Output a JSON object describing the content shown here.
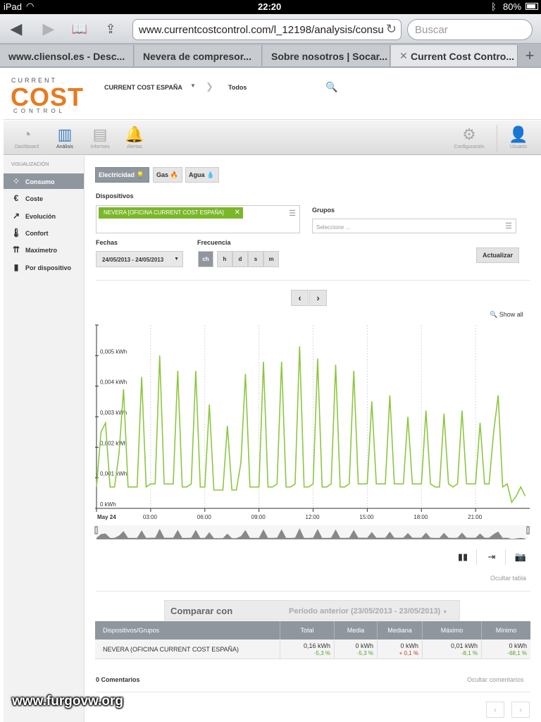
{
  "status_bar": {
    "device": "iPad",
    "time": "22:20",
    "battery": "80%"
  },
  "browser": {
    "url": "www.currentcostcontrol.com/l_12198/analysis/consu",
    "search_placeholder": "Buscar",
    "tabs": [
      {
        "title": "www.cliensol.es - Desc..."
      },
      {
        "title": "Nevera de compresor..."
      },
      {
        "title": "Sobre nosotros | Socar..."
      },
      {
        "title": "Current Cost Contro..."
      }
    ]
  },
  "header": {
    "logo": {
      "line1": "CURRENT",
      "line2": "COST",
      "line3": "CONTROL"
    },
    "organization": "CURRENT COST ESPAÑA",
    "scope": "Todos"
  },
  "nav": {
    "items": [
      {
        "label": "Dashboard",
        "icon": "gauge-icon"
      },
      {
        "label": "Análisis",
        "icon": "bar-chart-icon"
      },
      {
        "label": "Informes",
        "icon": "report-icon"
      },
      {
        "label": "Alertas",
        "icon": "bell-icon"
      },
      {
        "label": "Configuración",
        "icon": "gear-icon"
      },
      {
        "label": "Usuario",
        "icon": "user-icon"
      }
    ]
  },
  "sidebar": {
    "heading": "VISUALIZACIÓN",
    "items": [
      {
        "label": "Consumo",
        "icon": "consumption-icon"
      },
      {
        "label": "Coste",
        "icon": "euro-icon"
      },
      {
        "label": "Evolución",
        "icon": "line-chart-icon"
      },
      {
        "label": "Confort",
        "icon": "thermometer-icon"
      },
      {
        "label": "Maxímetro",
        "icon": "peak-icon"
      },
      {
        "label": "Por dispositivo",
        "icon": "bars-icon"
      }
    ]
  },
  "utilities": [
    {
      "label": "Electricidad"
    },
    {
      "label": "Gas"
    },
    {
      "label": "Agua"
    }
  ],
  "filters": {
    "devices_label": "Dispositivos",
    "device_chip": "NEVERA [OFICINA CURRENT COST ESPAÑA]",
    "groups_label": "Grupos",
    "groups_placeholder": "Seleccione ...",
    "dates_label": "Fechas",
    "date_range": "24/05/2013 - 24/05/2013",
    "frequency_label": "Frecuencia",
    "frequency_options": [
      "ch",
      "h",
      "d",
      "s",
      "m"
    ],
    "update_button": "Actualizar"
  },
  "chart_controls": {
    "show_all": "Show all",
    "hide_table": "Ocultar tabla"
  },
  "chart_data": {
    "type": "line",
    "title": "",
    "ylabel": "",
    "xlabel": "",
    "unit": "kWh",
    "y_ticks": [
      "0 kWh",
      "0,001 kWh",
      "0,002 kWh",
      "0,003 kWh",
      "0,004 kWh",
      "0,005 kWh"
    ],
    "ylim": [
      0,
      0.006
    ],
    "x_ticks": [
      "May 24",
      "03:00",
      "06:00",
      "09:00",
      "12:00",
      "15:00",
      "18:00",
      "21:00"
    ],
    "x_hours": [
      0,
      3,
      6,
      9,
      12,
      15,
      18,
      21
    ],
    "xlim_hours": [
      0,
      24
    ],
    "grid": true,
    "color": "#8dc63f",
    "series": [
      {
        "name": "",
        "hours": [
          0.0,
          0.25,
          0.5,
          0.75,
          1.0,
          1.25,
          1.5,
          1.75,
          2.0,
          2.25,
          2.5,
          2.75,
          3.0,
          3.25,
          3.5,
          3.75,
          4.0,
          4.25,
          4.5,
          4.75,
          5.0,
          5.25,
          5.5,
          5.75,
          6.0,
          6.25,
          6.5,
          6.75,
          7.0,
          7.25,
          7.5,
          7.75,
          8.0,
          8.25,
          8.5,
          8.75,
          9.0,
          9.25,
          9.5,
          9.75,
          10.0,
          10.25,
          10.5,
          10.75,
          11.0,
          11.25,
          11.5,
          11.75,
          12.0,
          12.25,
          12.5,
          12.75,
          13.0,
          13.25,
          13.5,
          13.75,
          14.0,
          14.25,
          14.5,
          14.75,
          15.0,
          15.25,
          15.5,
          15.75,
          16.0,
          16.25,
          16.5,
          16.75,
          17.0,
          17.25,
          17.5,
          17.75,
          18.0,
          18.25,
          18.5,
          18.75,
          19.0,
          19.25,
          19.5,
          19.75,
          20.0,
          20.25,
          20.5,
          20.75,
          21.0,
          21.25,
          21.5,
          21.75,
          22.0,
          22.25,
          22.5,
          22.75,
          23.0,
          23.25,
          23.5,
          23.75
        ],
        "values": [
          0.0007,
          0.0025,
          0.0028,
          0.0007,
          0.0007,
          0.0018,
          0.0039,
          0.0007,
          0.0007,
          0.0007,
          0.0043,
          0.0007,
          0.0008,
          0.0008,
          0.005,
          0.0008,
          0.0008,
          0.0008,
          0.0045,
          0.0007,
          0.0007,
          0.0008,
          0.0045,
          0.0007,
          0.0007,
          0.0034,
          0.0006,
          0.0006,
          0.0006,
          0.0027,
          0.0006,
          0.0006,
          0.0015,
          0.0044,
          0.0007,
          0.0007,
          0.0007,
          0.0048,
          0.0007,
          0.0007,
          0.0008,
          0.0048,
          0.0007,
          0.0007,
          0.0008,
          0.0053,
          0.0007,
          0.0007,
          0.0008,
          0.0049,
          0.0007,
          0.0007,
          0.0008,
          0.0047,
          0.0007,
          0.0007,
          0.0008,
          0.0045,
          0.0008,
          0.0008,
          0.0008,
          0.0035,
          0.0008,
          0.0008,
          0.0008,
          0.0037,
          0.0008,
          0.0008,
          0.0008,
          0.003,
          0.0008,
          0.0008,
          0.0008,
          0.0032,
          0.0008,
          0.0007,
          0.0007,
          0.0031,
          0.0008,
          0.0007,
          0.0008,
          0.0032,
          0.0008,
          0.0008,
          0.0008,
          0.0028,
          0.0008,
          0.0008,
          0.0025,
          0.0037,
          0.0007,
          0.0008,
          0.0002,
          0.0004,
          0.0007,
          0.0004
        ]
      }
    ]
  },
  "compare": {
    "label": "Comparar con",
    "period": "Período anterior (23/05/2013 - 23/05/2013)"
  },
  "table": {
    "columns": [
      "Dispositivos/Grupos",
      "Total",
      "Media",
      "Mediana",
      "Máximo",
      "Mínimo"
    ],
    "rows": [
      {
        "name": "NEVERA (OFICINA CURRENT COST ESPAÑA)",
        "cells": [
          {
            "value": "0,16 kWh",
            "delta": "-5,3 %",
            "dir": "neg"
          },
          {
            "value": "0 kWh",
            "delta": "-5,3 %",
            "dir": "neg"
          },
          {
            "value": "0 kWh",
            "delta": "+ 0,1 %",
            "dir": "pos"
          },
          {
            "value": "0,01 kWh",
            "delta": "-8,1 %",
            "dir": "neg"
          },
          {
            "value": "0 kWh",
            "delta": "-68,1 %",
            "dir": "neg"
          }
        ]
      }
    ]
  },
  "comments": {
    "count_label": "0 Comentarios",
    "hide_label": "Ocultar comentarios"
  },
  "watermark": "www.furgovw.org"
}
